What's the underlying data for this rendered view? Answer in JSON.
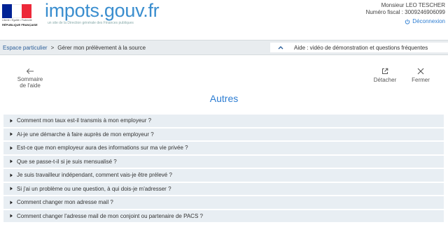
{
  "header": {
    "rf_motto": "Liberté • Égalité • Fraternité",
    "rf_name": "RÉPUBLIQUE FRANÇAISE",
    "logo": "impots.gouv.fr",
    "logo_sub": "un site de la Direction générale des Finances publiques",
    "user_name": "Monsieur LEO TESCHER",
    "fiscal_number": "Numéro fiscal : 3009246906099",
    "logout_label": "Déconnexion"
  },
  "breadcrumb": {
    "home": "Espace particulier",
    "separator": ">",
    "current": "Gérer mon prélèvement à la source"
  },
  "help_panel": {
    "label": "Aide : vidéo de démonstration et questions fréquentes"
  },
  "panel": {
    "back_label": "Sommaire de l'aide",
    "detach_label": "Détacher",
    "close_label": "Fermer",
    "title": "Autres"
  },
  "faq": [
    "Comment mon taux est-il transmis à mon employeur ?",
    "Ai-je une démarche à faire auprès de mon employeur ?",
    "Est-ce que mon employeur aura des informations sur ma vie privée ?",
    "Que se passe-t-il si je suis mensualisé ?",
    "Je suis travailleur indépendant, comment vais-je être prélevé ?",
    "Si j'ai un problème ou une question, à qui dois-je m'adresser ?",
    "Comment changer mon adresse mail ?",
    "Comment changer l'adresse mail de mon conjoint ou partenaire de PACS ?"
  ],
  "colors": {
    "accent": "#2d7dd2",
    "logo": "#3a8ecf",
    "item_bg": "#e8eef3",
    "bar_bg": "#e8ecef"
  }
}
